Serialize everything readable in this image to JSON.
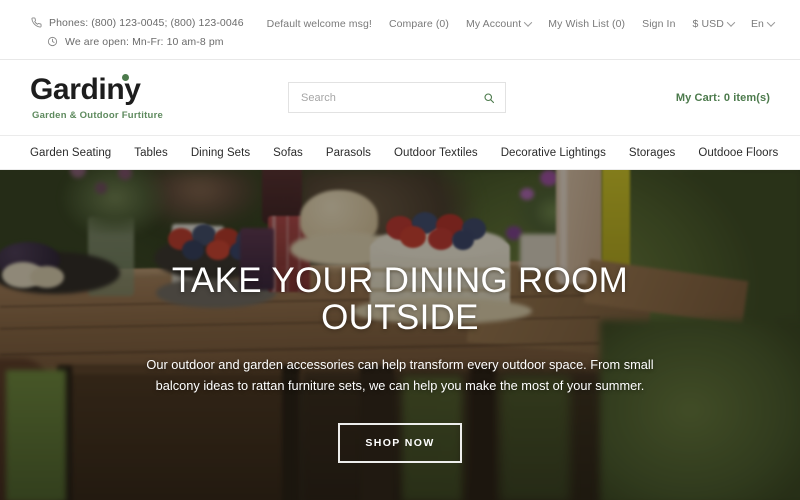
{
  "topbar": {
    "phone_icon": "phone-icon",
    "phones": "Phones: (800) 123-0045; (800) 123-0046",
    "clock_icon": "clock-icon",
    "hours": "We are open: Mn-Fr: 10 am-8 pm",
    "links": [
      {
        "label": "Default welcome msg!",
        "caret": false
      },
      {
        "label": "Compare (0)",
        "caret": false
      },
      {
        "label": "My Account",
        "caret": true
      },
      {
        "label": "My Wish List (0)",
        "caret": false
      },
      {
        "label": "Sign In",
        "caret": false
      },
      {
        "label": "$ USD",
        "caret": true
      },
      {
        "label": "En",
        "caret": true
      }
    ]
  },
  "brand": {
    "name": "Gardiny",
    "tagline": "Garden & Outdoor Furtiture",
    "dot_color": "#4c7a4c"
  },
  "search": {
    "placeholder": "Search",
    "value": "",
    "icon": "search-icon"
  },
  "cart": {
    "label": "My Cart: 0 item(s)",
    "color": "#4c7a4c"
  },
  "nav": {
    "items": [
      "Garden Seating",
      "Tables",
      "Dining Sets",
      "Sofas",
      "Parasols",
      "Outdoor Textiles",
      "Decorative Lightings",
      "Storages",
      "Outdooe Floors"
    ]
  },
  "hero": {
    "title": "TAKE YOUR DINING ROOM OUTSIDE",
    "subtitle": "Our outdoor and garden accessories can help transform every outdoor space. From small balcony ideas to rattan furniture sets, we can help you make the most of your summer.",
    "cta_label": "SHOP NOW"
  }
}
